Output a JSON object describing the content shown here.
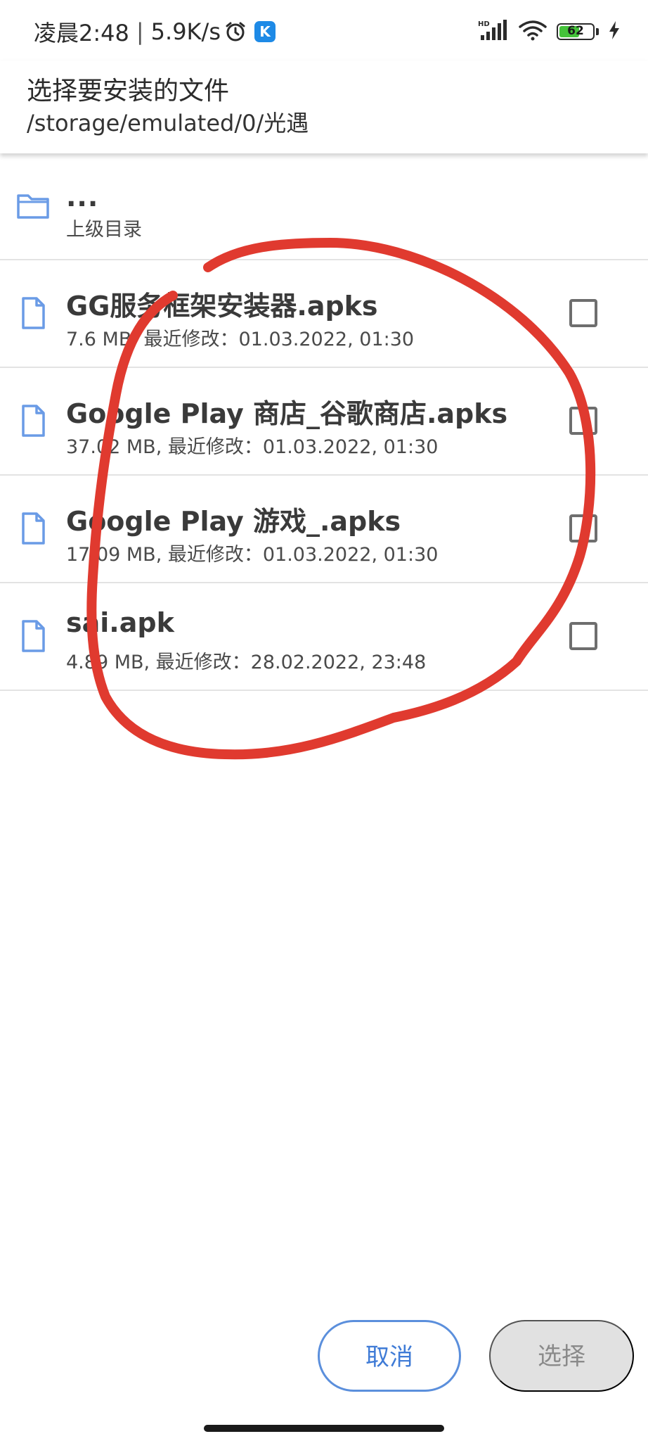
{
  "status_bar": {
    "time": "凌晨2:48",
    "separator": "|",
    "net_speed": "5.9K/s",
    "app_badge_letter": "K",
    "signal_label": "HD",
    "battery_level": "62",
    "battery_fraction": 0.62
  },
  "header": {
    "title": "选择要安装的文件",
    "path": "/storage/emulated/0/光遇"
  },
  "parent_dir": {
    "name": "...",
    "label": "上级目录"
  },
  "files": [
    {
      "name": "GG服务框架安装器.apks",
      "meta": "7.6 MB, 最近修改：01.03.2022, 01:30",
      "checked": false
    },
    {
      "name": "Google Play 商店_谷歌商店.apks",
      "meta": "37.02 MB, 最近修改：01.03.2022, 01:30",
      "checked": false
    },
    {
      "name": "Google Play 游戏_.apks",
      "meta": "17.09 MB, 最近修改：01.03.2022, 01:30",
      "checked": false
    },
    {
      "name": "sai.apk",
      "meta": "4.89 MB, 最近修改：28.02.2022, 23:48",
      "checked": false
    }
  ],
  "actions": {
    "cancel_label": "取消",
    "select_label": "选择"
  },
  "colors": {
    "accent": "#3f7bd6",
    "folder_icon": "#6a9be6",
    "annotation": "#e03a2f",
    "disabled_button": "#e1e1e1"
  }
}
